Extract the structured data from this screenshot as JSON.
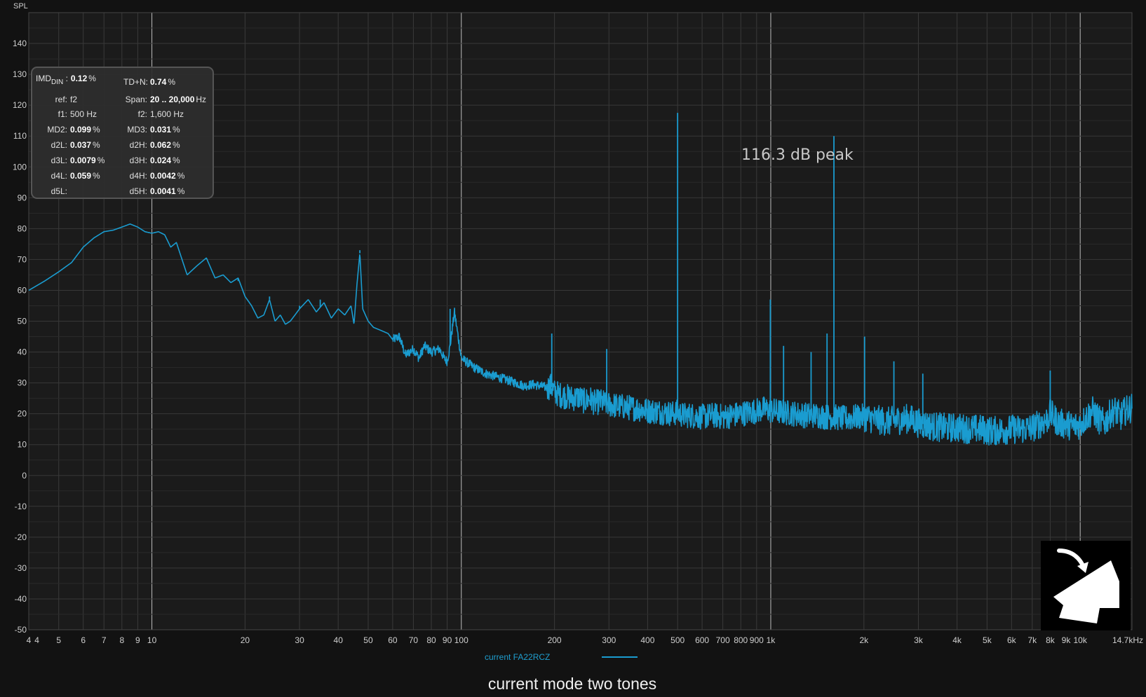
{
  "chart_data": {
    "type": "line",
    "ylabel": "SPL",
    "xscale": "log",
    "xlim": [
      4,
      14700
    ],
    "ylim": [
      -50,
      150
    ],
    "yticks": [
      -50,
      -40,
      -30,
      -20,
      -10,
      0,
      10,
      20,
      30,
      40,
      50,
      60,
      70,
      80,
      90,
      100,
      110,
      120,
      130,
      140
    ],
    "xticks": [
      {
        "v": 4,
        "label": "4"
      },
      {
        "v": 4.25,
        "label": "4"
      },
      {
        "v": 5,
        "label": "5"
      },
      {
        "v": 6,
        "label": "6"
      },
      {
        "v": 7,
        "label": "7"
      },
      {
        "v": 8,
        "label": "8"
      },
      {
        "v": 9,
        "label": "9"
      },
      {
        "v": 10,
        "label": "10"
      },
      {
        "v": 20,
        "label": "20"
      },
      {
        "v": 30,
        "label": "30"
      },
      {
        "v": 40,
        "label": "40"
      },
      {
        "v": 50,
        "label": "50"
      },
      {
        "v": 60,
        "label": "60"
      },
      {
        "v": 70,
        "label": "70"
      },
      {
        "v": 80,
        "label": "80"
      },
      {
        "v": 90,
        "label": "90"
      },
      {
        "v": 100,
        "label": "100"
      },
      {
        "v": 200,
        "label": "200"
      },
      {
        "v": 300,
        "label": "300"
      },
      {
        "v": 400,
        "label": "400"
      },
      {
        "v": 500,
        "label": "500"
      },
      {
        "v": 600,
        "label": "600"
      },
      {
        "v": 700,
        "label": "700"
      },
      {
        "v": 800,
        "label": "800"
      },
      {
        "v": 900,
        "label": "900"
      },
      {
        "v": 1000,
        "label": "1k"
      },
      {
        "v": 2000,
        "label": "2k"
      },
      {
        "v": 3000,
        "label": "3k"
      },
      {
        "v": 4000,
        "label": "4k"
      },
      {
        "v": 5000,
        "label": "5k"
      },
      {
        "v": 6000,
        "label": "6k"
      },
      {
        "v": 7000,
        "label": "7k"
      },
      {
        "v": 8000,
        "label": "8k"
      },
      {
        "v": 9000,
        "label": "9k"
      },
      {
        "v": 10000,
        "label": "10k"
      },
      {
        "v": 14700,
        "label": "14.7kHz"
      }
    ],
    "grid": true,
    "annotation": "116.3 dB peak",
    "caption": "current mode two tones",
    "series": [
      {
        "name": "current FA22RCZ",
        "color": "#1a9cd0",
        "x": [
          4,
          4.5,
          5,
          5.5,
          6,
          6.5,
          7,
          7.5,
          8,
          8.5,
          9,
          9.5,
          10,
          10.5,
          11,
          11.5,
          12,
          13,
          14,
          15,
          16,
          17,
          18,
          19,
          20,
          21,
          22,
          23,
          24,
          25,
          26,
          27,
          28,
          29,
          30,
          32,
          34,
          36,
          38,
          40,
          42,
          44,
          45,
          46,
          47,
          48,
          50,
          52,
          55,
          58,
          60,
          63,
          66,
          70,
          73,
          76,
          80,
          85,
          88,
          90,
          92,
          95,
          100,
          110,
          120,
          130,
          140,
          150,
          160,
          170,
          180,
          190,
          195,
          200,
          210,
          220,
          230,
          240,
          250,
          260,
          270,
          280,
          300,
          320,
          350,
          380,
          400,
          450,
          480,
          500,
          520,
          550,
          600,
          650,
          700,
          750,
          800,
          850,
          900,
          950,
          1000,
          1100,
          1200,
          1300,
          1400,
          1500,
          1600,
          1700,
          1800,
          1900,
          2000,
          2200,
          2400,
          2600,
          2800,
          3000,
          3300,
          3600,
          4000,
          4400,
          4800,
          5000,
          5500,
          6000,
          6500,
          7000,
          7500,
          7800,
          8000,
          8200,
          8500,
          9000,
          9500,
          10000,
          10500,
          11000,
          11500,
          12000,
          12500,
          13000,
          13500,
          14000,
          14700
        ],
        "y": [
          60,
          63,
          66,
          69,
          74,
          77,
          79,
          79.5,
          80.5,
          81.5,
          80.5,
          79,
          78.5,
          79,
          78,
          74,
          75.5,
          65,
          68,
          70.5,
          64,
          65,
          62.5,
          64,
          58,
          55,
          51,
          52,
          57,
          50,
          52,
          49,
          50,
          52,
          54,
          57,
          53,
          56,
          51,
          54,
          52,
          55,
          49,
          62,
          72,
          54,
          50,
          48,
          47,
          46,
          44,
          45,
          39,
          41,
          38,
          42,
          40,
          41,
          38,
          37,
          42,
          53,
          38,
          35,
          33,
          32,
          31,
          30,
          29,
          29.5,
          29,
          28.5,
          29,
          27,
          26,
          25.5,
          25,
          25.5,
          24,
          25,
          23.5,
          24,
          23,
          22.5,
          22,
          21.5,
          21,
          20.5,
          20,
          20.5,
          19.5,
          19.5,
          19,
          19.5,
          19,
          19.5,
          20,
          20.5,
          21,
          21.5,
          21,
          20.5,
          20,
          19.5,
          19.5,
          19,
          19,
          18.5,
          18.5,
          19,
          19,
          18,
          17.5,
          18,
          18.5,
          17,
          16,
          15.5,
          15.5,
          15,
          15,
          14.5,
          14.5,
          15,
          15,
          15.5,
          17,
          18,
          20,
          19,
          17,
          16.5,
          16,
          16.5,
          19,
          21,
          18,
          17,
          20,
          21,
          19,
          21,
          22
        ]
      }
    ],
    "peaks": [
      {
        "x": 19,
        "y": 63
      },
      {
        "x": 24,
        "y": 58
      },
      {
        "x": 30,
        "y": 55
      },
      {
        "x": 35,
        "y": 57
      },
      {
        "x": 47,
        "y": 73
      },
      {
        "x": 92,
        "y": 54
      },
      {
        "x": 196,
        "y": 46
      },
      {
        "x": 295,
        "y": 41
      },
      {
        "x": 500,
        "y": 117.5
      },
      {
        "x": 997,
        "y": 57
      },
      {
        "x": 1100,
        "y": 42
      },
      {
        "x": 1350,
        "y": 40
      },
      {
        "x": 1520,
        "y": 46
      },
      {
        "x": 1600,
        "y": 110
      },
      {
        "x": 2010,
        "y": 45
      },
      {
        "x": 2500,
        "y": 37
      },
      {
        "x": 3100,
        "y": 33
      },
      {
        "x": 8000,
        "y": 34
      }
    ]
  },
  "stats": {
    "imd_label": "IMD",
    "imd_sub": "DIN",
    "imd_value": "0.12",
    "imd_unit": "%",
    "tdn_label": "TD+N:",
    "tdn_value": "0.74",
    "tdn_unit": "%",
    "ref_label": "ref:",
    "ref_value": "f2",
    "span_label": "Span:",
    "span_value": "20 .. 20,000",
    "span_unit": "Hz",
    "f1_label": "f1:",
    "f1_value": "500 Hz",
    "f2_label": "f2:",
    "f2_value": "1,600 Hz",
    "md2_label": "MD2:",
    "md2_value": "0.099",
    "md2_unit": "%",
    "md3_label": "MD3:",
    "md3_value": "0.031",
    "md3_unit": "%",
    "d2l_label": "d2L:",
    "d2l_value": "0.037",
    "d2l_unit": "%",
    "d2h_label": "d2H:",
    "d2h_value": "0.062",
    "d2h_unit": "%",
    "d3l_label": "d3L:",
    "d3l_value": "0.0079",
    "d3l_unit": "%",
    "d3h_label": "d3H:",
    "d3h_value": "0.024",
    "d3h_unit": "%",
    "d4l_label": "d4L:",
    "d4l_value": "0.059",
    "d4l_unit": "%",
    "d4h_label": "d4H:",
    "d4h_value": "0.0042",
    "d4h_unit": "%",
    "d5l_label": "d5L:",
    "d5h_label": "d5H:",
    "d5h_value": "0.0041",
    "d5h_unit": "%"
  },
  "logo": {
    "icon": "house-arrow-icon"
  }
}
